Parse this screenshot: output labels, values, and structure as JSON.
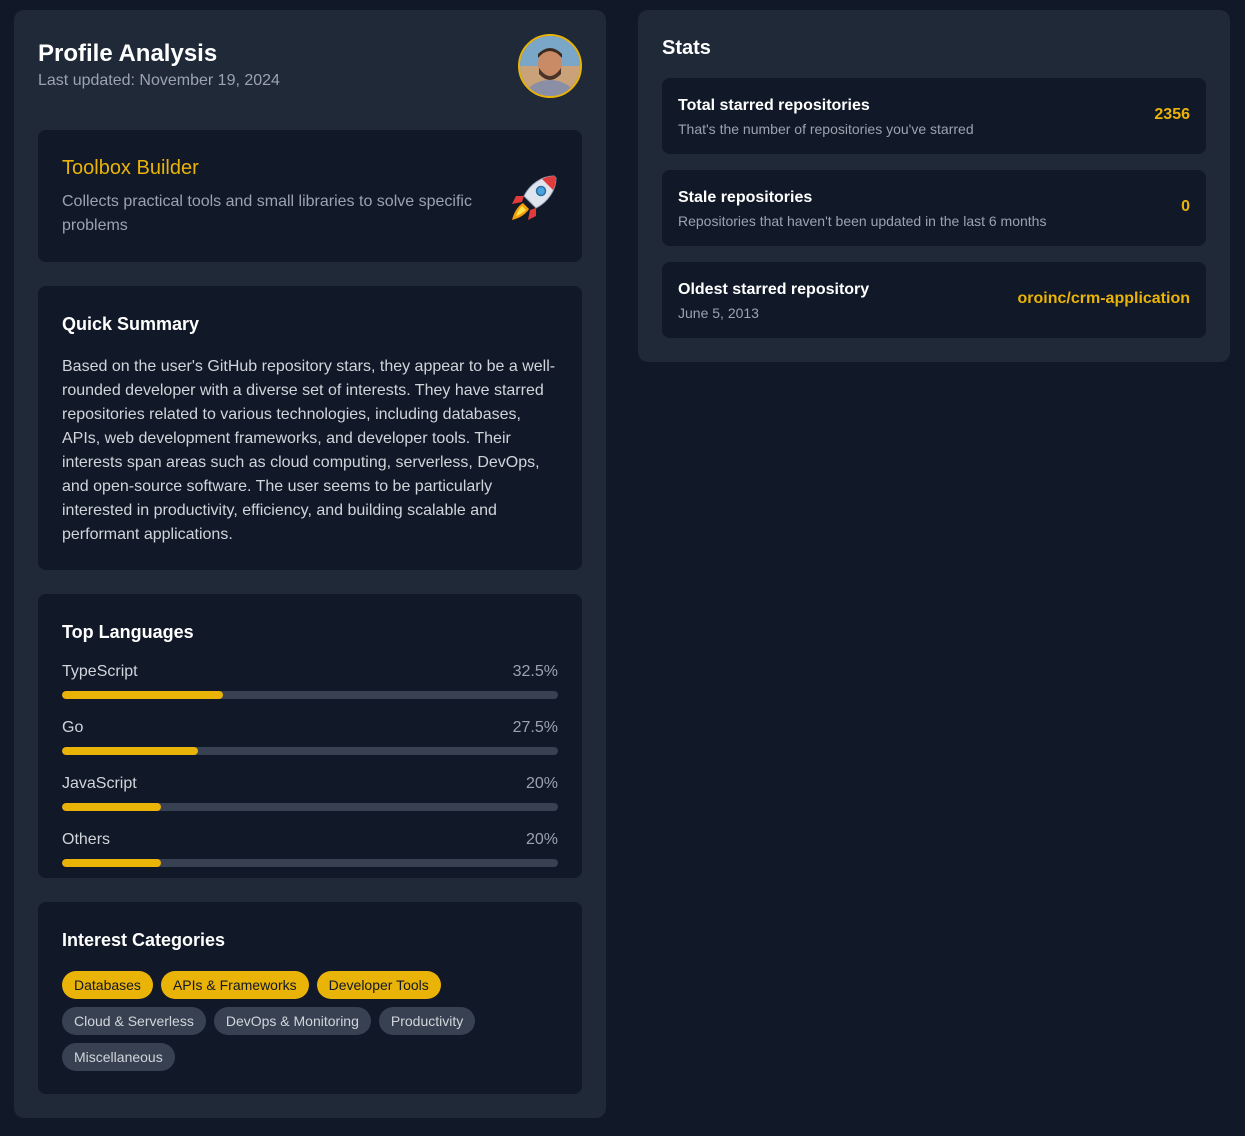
{
  "profile": {
    "title": "Profile Analysis",
    "last_updated": "Last updated: November 19, 2024",
    "avatar_icon": "user-avatar"
  },
  "persona": {
    "title": "Toolbox Builder",
    "description": "Collects practical tools and small libraries to solve specific problems",
    "icon": "rocket-icon"
  },
  "summary": {
    "heading": "Quick Summary",
    "text": "Based on the user's GitHub repository stars, they appear to be a well-rounded developer with a diverse set of interests. They have starred repositories related to various technologies, including databases, APIs, web development frameworks, and developer tools. Their interests span areas such as cloud computing, serverless, DevOps, and open-source software. The user seems to be particularly interested in productivity, efficiency, and building scalable and performant applications."
  },
  "languages": {
    "heading": "Top Languages",
    "items": [
      {
        "name": "TypeScript",
        "percent_label": "32.5%",
        "percent": 32.5
      },
      {
        "name": "Go",
        "percent_label": "27.5%",
        "percent": 27.5
      },
      {
        "name": "JavaScript",
        "percent_label": "20%",
        "percent": 20
      },
      {
        "name": "Others",
        "percent_label": "20%",
        "percent": 20
      }
    ]
  },
  "interests": {
    "heading": "Interest Categories",
    "chips": [
      {
        "label": "Databases",
        "highlighted": true
      },
      {
        "label": "APIs & Frameworks",
        "highlighted": true
      },
      {
        "label": "Developer Tools",
        "highlighted": true
      },
      {
        "label": "Cloud & Serverless",
        "highlighted": false
      },
      {
        "label": "DevOps & Monitoring",
        "highlighted": false
      },
      {
        "label": "Productivity",
        "highlighted": false
      },
      {
        "label": "Miscellaneous",
        "highlighted": false
      }
    ]
  },
  "stats": {
    "heading": "Stats",
    "items": [
      {
        "label": "Total starred repositories",
        "sub": "That's the number of repositories you've starred",
        "value": "2356"
      },
      {
        "label": "Stale repositories",
        "sub": "Repositories that haven't been updated in the last 6 months",
        "value": "0"
      },
      {
        "label": "Oldest starred repository",
        "sub": "June 5, 2013",
        "value": "oroinc/crm-application"
      }
    ]
  },
  "colors": {
    "accent": "#eab308",
    "background": "#111827",
    "panel": "#1f2937"
  }
}
